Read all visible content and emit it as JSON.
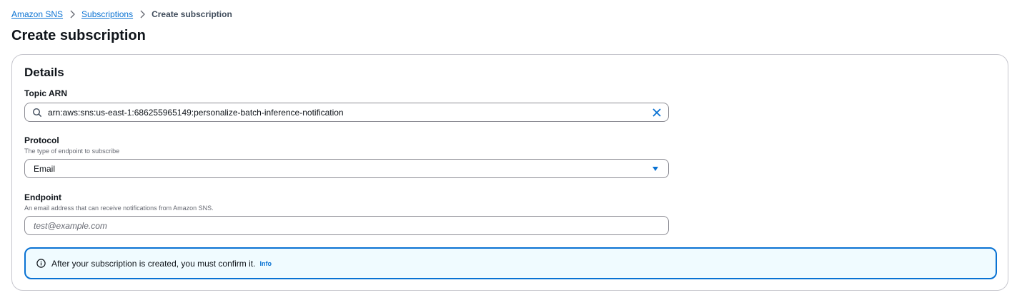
{
  "breadcrumb": {
    "items": [
      "Amazon SNS",
      "Subscriptions"
    ],
    "current": "Create subscription"
  },
  "page": {
    "title": "Create subscription"
  },
  "details": {
    "title": "Details",
    "topic_arn": {
      "label": "Topic ARN",
      "value": "arn:aws:sns:us-east-1:686255965149:personalize-batch-inference-notification"
    },
    "protocol": {
      "label": "Protocol",
      "description": "The type of endpoint to subscribe",
      "value": "Email"
    },
    "endpoint": {
      "label": "Endpoint",
      "description": "An email address that can receive notifications from Amazon SNS.",
      "placeholder": "test@example.com"
    },
    "alert": {
      "text": "After your subscription is created, you must confirm it.",
      "link": "Info"
    }
  },
  "colors": {
    "link": "#0972d3",
    "alert_bg": "#f0fbff",
    "alert_border": "#0972d3",
    "border": "#8c8c94"
  },
  "icons": [
    "chevron-right-icon",
    "search-icon",
    "clear-icon",
    "caret-down-icon",
    "info-icon"
  ]
}
